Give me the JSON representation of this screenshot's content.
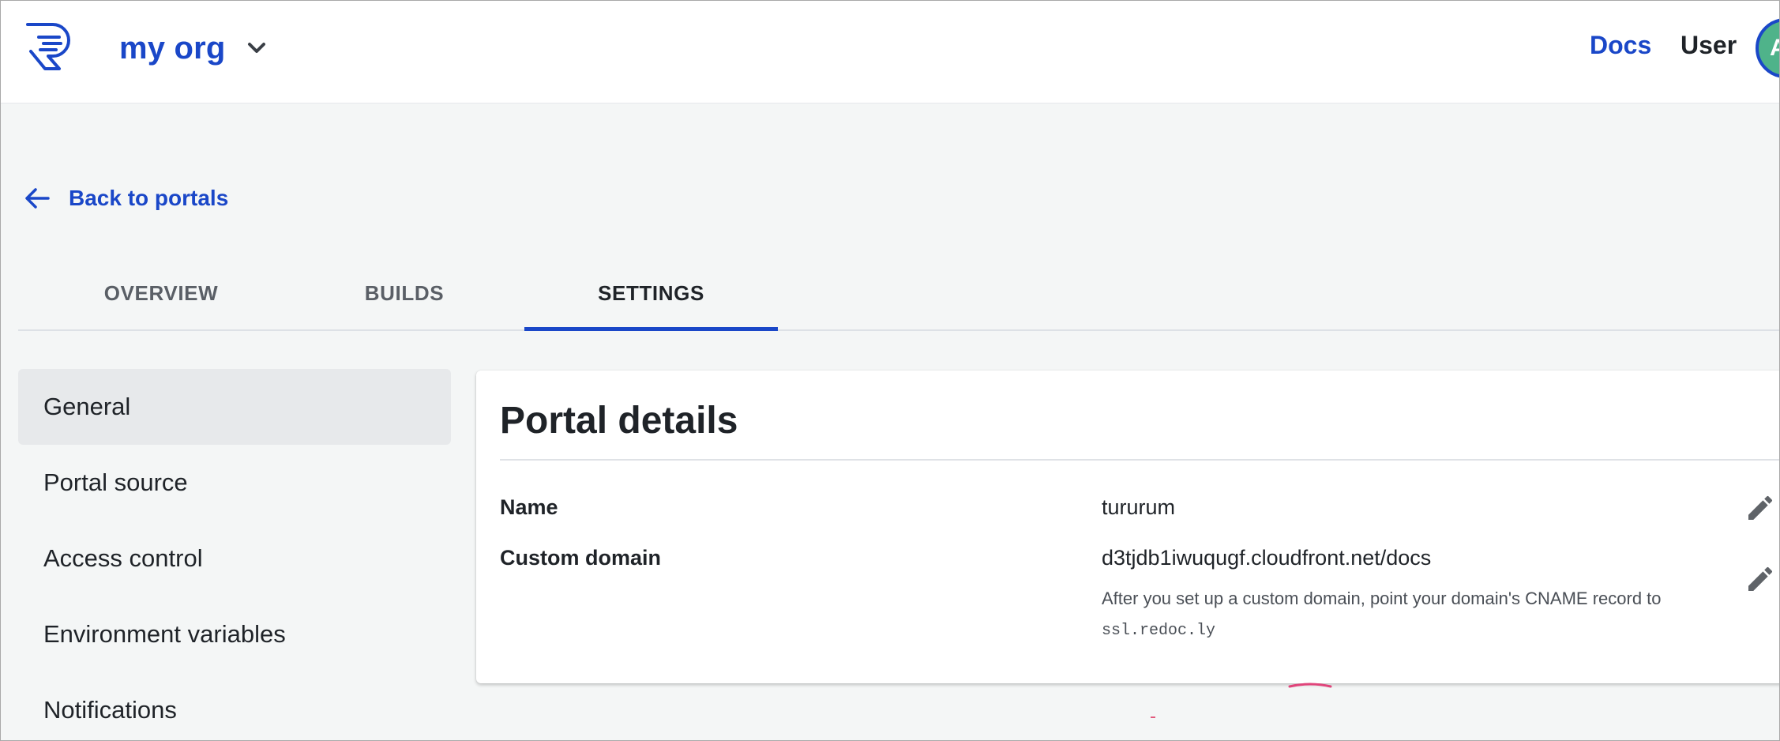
{
  "header": {
    "org_name": "my org",
    "docs_label": "Docs",
    "user_label": "User",
    "avatar_initial": "A"
  },
  "back_link": {
    "label": "Back to portals"
  },
  "tabs": [
    {
      "label": "OVERVIEW"
    },
    {
      "label": "BUILDS"
    },
    {
      "label": "SETTINGS",
      "active": true
    }
  ],
  "sidebar": {
    "items": [
      {
        "label": "General",
        "active": true
      },
      {
        "label": "Portal source"
      },
      {
        "label": "Access control"
      },
      {
        "label": "Environment variables"
      },
      {
        "label": "Notifications"
      }
    ]
  },
  "panel": {
    "title": "Portal details",
    "name_label": "Name",
    "name_value": "tururum",
    "domain_label": "Custom domain",
    "domain_value": "d3tjdb1iwuqugf.cloudfront.net/docs",
    "domain_hint": "After you set up a custom domain, point your domain's CNAME record to",
    "cname_target": "ssl.redoc.ly"
  },
  "icons": {
    "logo": "redocly-logo",
    "org_dropdown": "chevron-down-icon",
    "back": "arrow-left-icon",
    "edit": "pencil-icon"
  },
  "colors": {
    "accent": "#1a47c8",
    "avatar_bg": "#4fb38a",
    "page_bg": "#f4f6f6"
  }
}
